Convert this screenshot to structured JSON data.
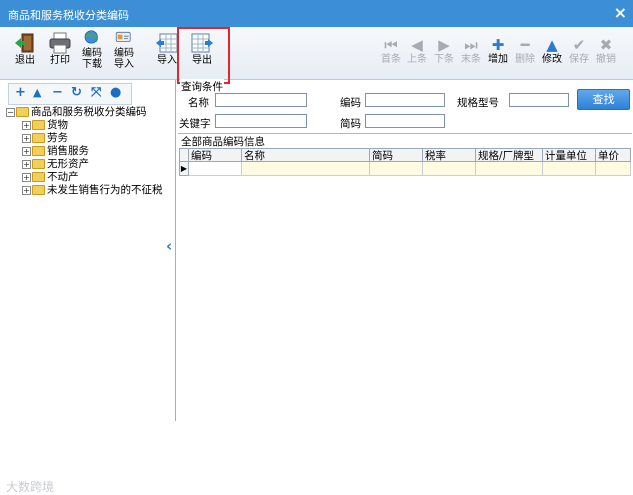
{
  "window": {
    "title": "商品和服务税收分类编码",
    "close_glyph": "×"
  },
  "toolbar": {
    "left_buttons": [
      {
        "label_lines": [
          "退出"
        ],
        "icon": "exit-door-icon"
      },
      {
        "label_lines": [
          "打印"
        ],
        "icon": "printer-icon"
      },
      {
        "label_lines": [
          "编码",
          "下载"
        ],
        "icon": "globe-download-icon"
      },
      {
        "label_lines": [
          "编码",
          "导入"
        ],
        "icon": "card-import-icon"
      },
      {
        "label_lines": [
          "导入"
        ],
        "icon": "table-import-icon"
      },
      {
        "label_lines": [
          "导出"
        ],
        "icon": "table-export-icon"
      }
    ],
    "right_buttons": [
      {
        "label": "首条",
        "glyph": "⏮",
        "enabled": false
      },
      {
        "label": "上条",
        "glyph": "◀",
        "enabled": false
      },
      {
        "label": "下条",
        "glyph": "▶",
        "enabled": false
      },
      {
        "label": "末条",
        "glyph": "⏭",
        "enabled": false
      },
      {
        "label": "增加",
        "glyph": "✚",
        "enabled": true
      },
      {
        "label": "删除",
        "glyph": "━",
        "enabled": false
      },
      {
        "label": "修改",
        "glyph": "▲",
        "enabled": true
      },
      {
        "label": "保存",
        "glyph": "✔",
        "enabled": false
      },
      {
        "label": "撤销",
        "glyph": "✖",
        "enabled": false
      }
    ]
  },
  "tree_tools": [
    "+",
    "▲",
    "−",
    "↻",
    "⤧",
    "●"
  ],
  "tree": {
    "root": "商品和服务税收分类编码",
    "children": [
      "货物",
      "劳务",
      "销售服务",
      "无形资产",
      "不动产",
      "未发生销售行为的不征税"
    ]
  },
  "query": {
    "caption": "查询条件",
    "name_label": "名称",
    "code_label": "编码",
    "spec_label": "规格型号",
    "keyword_label": "关键字",
    "short_code_label": "简码",
    "name_value": "",
    "code_value": "",
    "spec_value": "",
    "keyword_value": "",
    "short_code_value": "",
    "search_button": "查找"
  },
  "results": {
    "caption": "全部商品编码信息",
    "columns": [
      "编码",
      "名称",
      "简码",
      "税率",
      "规格/厂牌型号",
      "计量单位",
      "单价"
    ],
    "row_indicator": "▶"
  },
  "watermark": "大数跨境",
  "colors": {
    "title_bar": "#3c8fd6",
    "highlight": "#e2262a",
    "search_button": "#2f81d6",
    "row_highlight": "#fffbe0"
  }
}
